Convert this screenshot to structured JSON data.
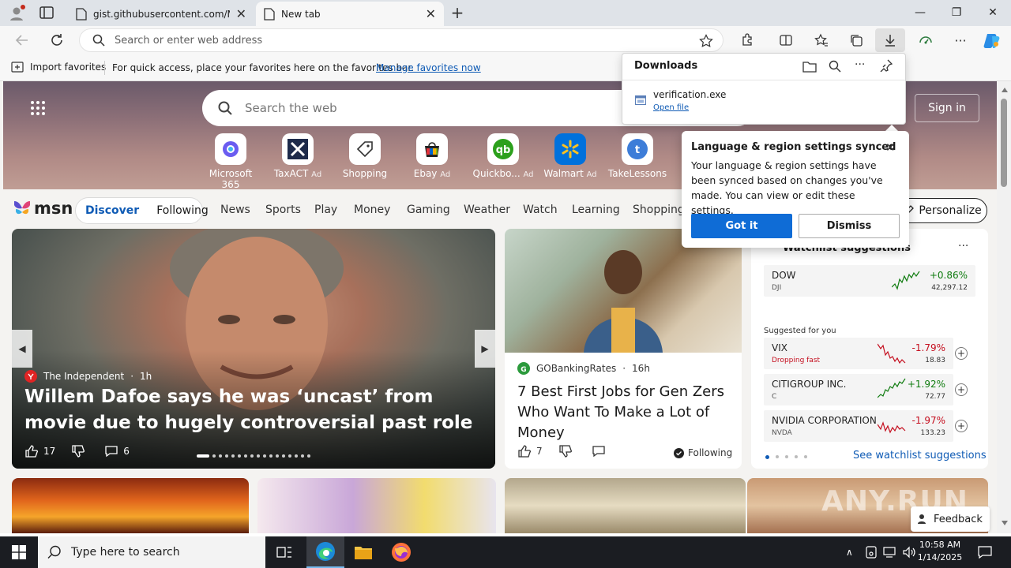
{
  "browser": {
    "tabs": [
      {
        "title": "gist.githubusercontent.com/Mar"
      },
      {
        "title": "New tab"
      }
    ],
    "address_placeholder": "Search or enter web address"
  },
  "favorites_bar": {
    "import_label": "Import favorites",
    "hint": "For quick access, place your favorites here on the favorites bar.",
    "manage_link": "Manage favorites now"
  },
  "downloads": {
    "title": "Downloads",
    "file_name": "verification.exe",
    "open_label": "Open file"
  },
  "popup": {
    "title": "Language & region settings synced",
    "body": "Your language & region settings have been synced based on changes you've made. You can view or edit these settings.",
    "primary": "Got it",
    "secondary": "Dismiss"
  },
  "msn": {
    "search_placeholder": "Search the web",
    "sign_in": "Sign in",
    "quick_links": [
      {
        "label": "Microsoft 365",
        "ad": ""
      },
      {
        "label": "TaxACT",
        "ad": "Ad"
      },
      {
        "label": "Shopping",
        "ad": ""
      },
      {
        "label": "Ebay",
        "ad": "Ad"
      },
      {
        "label": "Quickbo...",
        "ad": "Ad"
      },
      {
        "label": "Walmart",
        "ad": "Ad"
      },
      {
        "label": "TakeLessons",
        "ad": ""
      }
    ],
    "logo": "msn",
    "feed_tabs": [
      "Discover",
      "Following"
    ],
    "nav": [
      "News",
      "Sports",
      "Play",
      "Money",
      "Gaming",
      "Weather",
      "Watch",
      "Learning",
      "Shopping"
    ],
    "personalize": "Personalize",
    "hero_story": {
      "source": "The Independent",
      "age": "1h",
      "headline": "Willem Dafoe says he was ‘uncast’ from movie due to hugely controversial past role",
      "likes": "17",
      "comments": "6"
    },
    "side_story": {
      "source": "GOBankingRates",
      "age": "16h",
      "headline": "7 Best First Jobs for Gen Zers Who Want To Make a Lot of Money",
      "likes": "7",
      "following": "Following"
    },
    "watchlist": {
      "title": "Watchlist suggestions",
      "main": {
        "name": "DOW",
        "ticker": "DJI",
        "change": "+0.86%",
        "price": "42,297.12"
      },
      "suggested_label": "Suggested for you",
      "items": [
        {
          "name": "VIX",
          "ticker": "Dropping fast",
          "change": "-1.79%",
          "price": "18.83"
        },
        {
          "name": "CITIGROUP INC.",
          "ticker": "C",
          "change": "+1.92%",
          "price": "72.77"
        },
        {
          "name": "NVIDIA CORPORATION",
          "ticker": "NVDA",
          "change": "-1.97%",
          "price": "133.23"
        }
      ],
      "link": "See watchlist suggestions"
    },
    "feedback": "Feedback"
  },
  "colors": {
    "accent": "#0f6cd6",
    "up": "#107c10",
    "down": "#c50f1f",
    "msn_blue": "#0f5bb5"
  },
  "taskbar": {
    "search_placeholder": "Type here to search",
    "time": "10:58 AM",
    "date": "1/14/2025"
  }
}
